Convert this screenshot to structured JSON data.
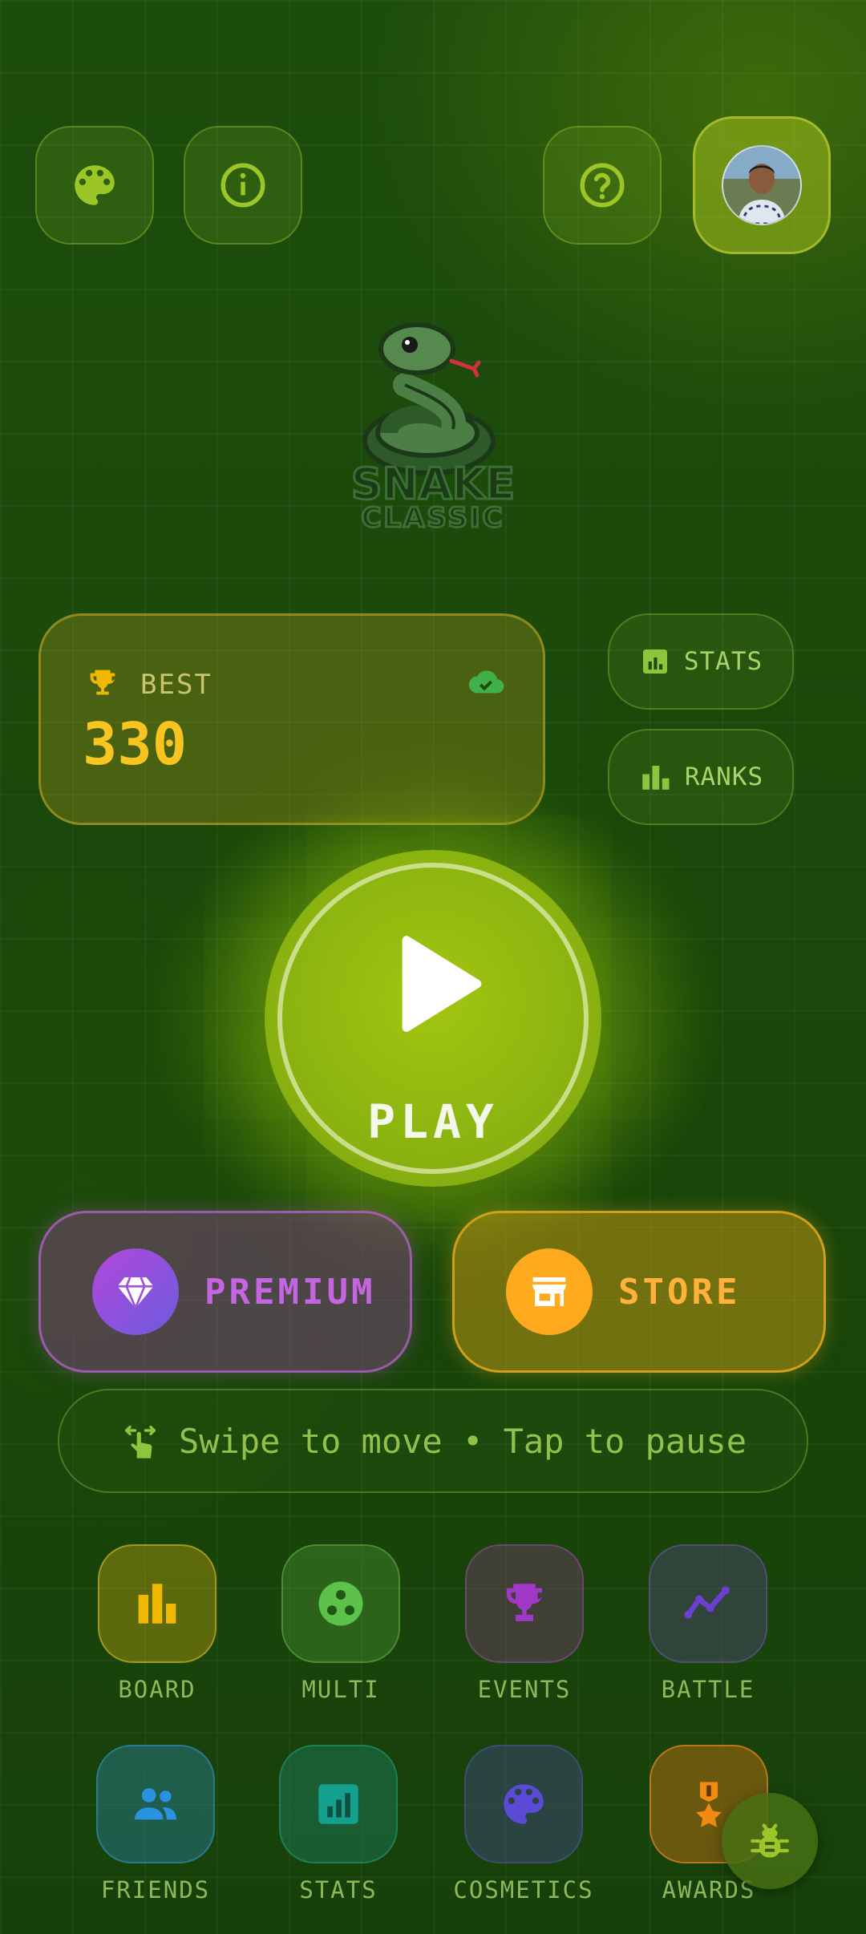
{
  "top_bar": {
    "theme_icon": "palette-icon",
    "info_icon": "info-icon",
    "help_icon": "help-icon",
    "profile_icon": "avatar"
  },
  "logo": {
    "title": "SNAKE",
    "subtitle": "CLASSIC"
  },
  "best_card": {
    "label": "BEST",
    "value": "330",
    "trophy_icon": "trophy-icon",
    "sync_icon": "cloud-check-icon"
  },
  "side_buttons": {
    "stats_label": "STATS",
    "ranks_label": "RANKS"
  },
  "play": {
    "label": "PLAY"
  },
  "premium": {
    "label": "PREMIUM"
  },
  "store": {
    "label": "STORE"
  },
  "hint": {
    "text": "Swipe to move • Tap to pause"
  },
  "nav_grid": [
    {
      "label": "BOARD",
      "icon": "bar-chart-icon",
      "color": "#f0b800"
    },
    {
      "label": "MULTI",
      "icon": "multiplayer-icon",
      "color": "#5cc24a"
    },
    {
      "label": "EVENTS",
      "icon": "trophy-icon",
      "color": "#a038c8"
    },
    {
      "label": "BATTLE",
      "icon": "line-chart-icon",
      "color": "#6b3fd1"
    },
    {
      "label": "FRIENDS",
      "icon": "people-icon",
      "color": "#2a93e0"
    },
    {
      "label": "STATS",
      "icon": "stats-icon",
      "color": "#13a08e"
    },
    {
      "label": "COSMETICS",
      "icon": "palette-icon",
      "color": "#5a4ad6"
    },
    {
      "label": "AWARDS",
      "icon": "medal-icon",
      "color": "#f08a10"
    }
  ],
  "colors": {
    "accent": "#9cc314",
    "best_value": "#f8c520",
    "premium": "#c060e0",
    "store": "#f5a623"
  }
}
